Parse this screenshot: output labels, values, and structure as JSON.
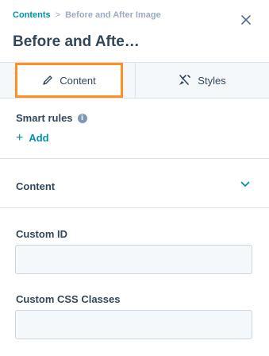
{
  "header": {
    "breadcrumb_root": "Contents",
    "breadcrumb_separator": ">",
    "breadcrumb_current": "Before and After Image",
    "title": "Before and Afte…",
    "close_icon": "close-icon"
  },
  "tabs": [
    {
      "label": "Content",
      "icon": "pencil-icon",
      "active": true
    },
    {
      "label": "Styles",
      "icon": "brush-icon",
      "active": false
    }
  ],
  "smart_rules": {
    "label": "Smart rules",
    "info_glyph": "i",
    "add_label": "Add",
    "add_glyph": "+"
  },
  "section": {
    "title": "Content",
    "expanded": true
  },
  "fields": {
    "custom_id": {
      "label": "Custom ID",
      "value": ""
    },
    "custom_css": {
      "label": "Custom CSS Classes",
      "value": ""
    }
  },
  "colors": {
    "accent_link": "#0091ae",
    "highlight": "#ff8f21",
    "text": "#33475b",
    "muted": "#99acc2"
  }
}
